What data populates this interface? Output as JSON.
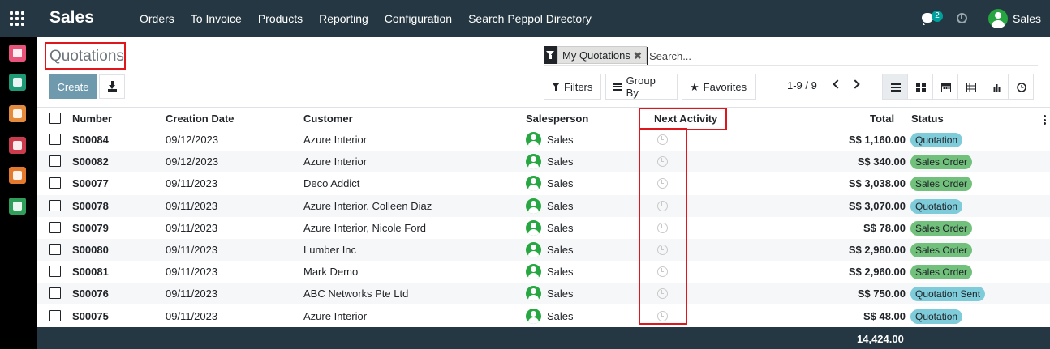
{
  "navbar": {
    "app_name": "Sales",
    "menu": [
      "Orders",
      "To Invoice",
      "Products",
      "Reporting",
      "Configuration",
      "Search Peppol Directory"
    ],
    "chat_count": "2",
    "user": "Sales"
  },
  "sidebar": {
    "apps": [
      {
        "name": "discuss",
        "color": "#e9557a"
      },
      {
        "name": "contacts",
        "color": "#1f9a77"
      },
      {
        "name": "sales",
        "color": "#e48a3c"
      },
      {
        "name": "inventory",
        "color": "#c93b4d"
      },
      {
        "name": "invoicing",
        "color": "#e3792d"
      },
      {
        "name": "documents",
        "color": "#2f9e5a"
      }
    ]
  },
  "control_panel": {
    "title": "Quotations",
    "create_label": "Create",
    "facet_label": "My Quotations",
    "search_placeholder": "Search...",
    "filters_label": "Filters",
    "groupby_label": "Group By",
    "favorites_label": "Favorites",
    "pager": "1-9 / 9"
  },
  "columns": {
    "number": "Number",
    "creation_date": "Creation Date",
    "customer": "Customer",
    "salesperson": "Salesperson",
    "next_activity": "Next Activity",
    "total": "Total",
    "status": "Status"
  },
  "rows": [
    {
      "number": "S00084",
      "date": "09/12/2023",
      "customer": "Azure Interior",
      "salesperson": "Sales",
      "total": "S$ 1,160.00",
      "status": "Quotation",
      "status_kind": "quotation"
    },
    {
      "number": "S00082",
      "date": "09/12/2023",
      "customer": "Azure Interior",
      "salesperson": "Sales",
      "total": "S$ 340.00",
      "status": "Sales Order",
      "status_kind": "order"
    },
    {
      "number": "S00077",
      "date": "09/11/2023",
      "customer": "Deco Addict",
      "salesperson": "Sales",
      "total": "S$ 3,038.00",
      "status": "Sales Order",
      "status_kind": "order"
    },
    {
      "number": "S00078",
      "date": "09/11/2023",
      "customer": "Azure Interior, Colleen Diaz",
      "salesperson": "Sales",
      "total": "S$ 3,070.00",
      "status": "Quotation",
      "status_kind": "quotation"
    },
    {
      "number": "S00079",
      "date": "09/11/2023",
      "customer": "Azure Interior, Nicole Ford",
      "salesperson": "Sales",
      "total": "S$ 78.00",
      "status": "Sales Order",
      "status_kind": "order"
    },
    {
      "number": "S00080",
      "date": "09/11/2023",
      "customer": "Lumber Inc",
      "salesperson": "Sales",
      "total": "S$ 2,980.00",
      "status": "Sales Order",
      "status_kind": "order"
    },
    {
      "number": "S00081",
      "date": "09/11/2023",
      "customer": "Mark Demo",
      "salesperson": "Sales",
      "total": "S$ 2,960.00",
      "status": "Sales Order",
      "status_kind": "order"
    },
    {
      "number": "S00076",
      "date": "09/11/2023",
      "customer": "ABC Networks Pte Ltd",
      "salesperson": "Sales",
      "total": "S$ 750.00",
      "status": "Quotation Sent",
      "status_kind": "quotation"
    },
    {
      "number": "S00075",
      "date": "09/11/2023",
      "customer": "Azure Interior",
      "salesperson": "Sales",
      "total": "S$ 48.00",
      "status": "Quotation",
      "status_kind": "quotation"
    }
  ],
  "footer": {
    "grand_total": "14,424.00"
  },
  "colors": {
    "navbar": "#243742",
    "create_button": "#6f9aae",
    "badge_quotation": "#7ecbd9",
    "badge_order": "#71c07b",
    "highlight": "#e0161d"
  }
}
